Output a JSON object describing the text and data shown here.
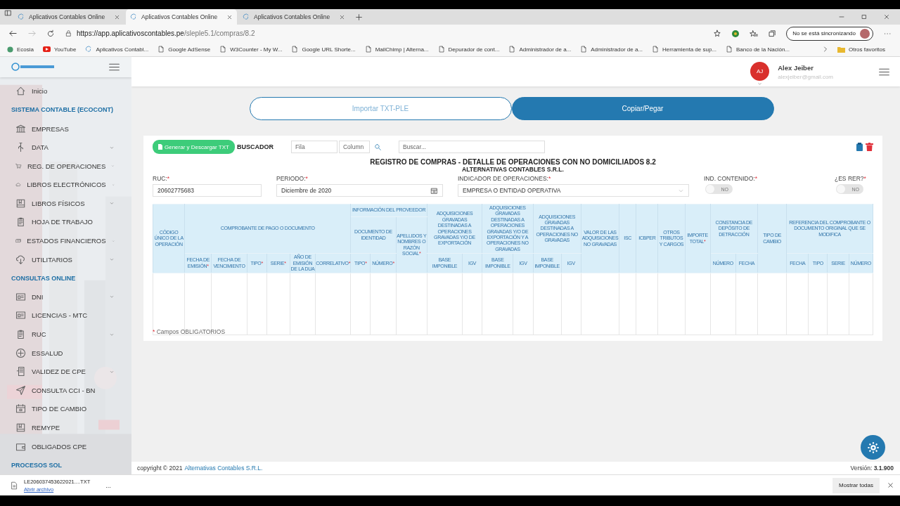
{
  "browser": {
    "tabs": [
      {
        "title": "Aplicativos Contables Online",
        "selected": false
      },
      {
        "title": "Aplicativos Contables Online",
        "selected": true
      },
      {
        "title": "Aplicativos Contables Online",
        "selected": false
      }
    ],
    "url_host": "https://app.aplicativoscontables.pe",
    "url_path": "/sleple5.1/compras/8.2",
    "sync_status": "No se está sincronizando",
    "bookmarks": [
      {
        "label": "Ecosia",
        "kind": "leaf"
      },
      {
        "label": "YouTube",
        "kind": "video"
      },
      {
        "label": "Aplicativos Contabl...",
        "kind": "site"
      },
      {
        "label": "Google AdSense",
        "kind": "page"
      },
      {
        "label": "W3Counter - My W...",
        "kind": "page"
      },
      {
        "label": "Google URL Shorte...",
        "kind": "page"
      },
      {
        "label": "MailChimp | Alterna...",
        "kind": "page"
      },
      {
        "label": "Depurador de cont...",
        "kind": "page"
      },
      {
        "label": "Administrador de a...",
        "kind": "page"
      },
      {
        "label": "Administrador de a...",
        "kind": "page"
      },
      {
        "label": "Herramienta de sup...",
        "kind": "page"
      },
      {
        "label": "Banco de la Nación...",
        "kind": "page"
      }
    ],
    "other_bookmarks": "Otros favoritos"
  },
  "sidebar": {
    "items": [
      {
        "kind": "link",
        "label": "Inicio",
        "expandable": false
      },
      {
        "kind": "heading",
        "label": "SISTEMA CONTABLE (ECOCONT)"
      },
      {
        "kind": "link",
        "label": "EMPRESAS",
        "expandable": false
      },
      {
        "kind": "link",
        "label": "DATA",
        "expandable": true
      },
      {
        "kind": "link",
        "label": "REG. DE OPERACIONES",
        "expandable": true
      },
      {
        "kind": "link",
        "label": "LIBROS ELECTRÓNICOS",
        "expandable": true
      },
      {
        "kind": "link",
        "label": "LIBROS FÍSICOS",
        "expandable": true
      },
      {
        "kind": "link",
        "label": "HOJA DE TRABAJO",
        "expandable": false
      },
      {
        "kind": "link",
        "label": "ESTADOS FINANCIEROS",
        "expandable": true
      },
      {
        "kind": "link",
        "label": "UTILITARIOS",
        "expandable": true
      },
      {
        "kind": "heading",
        "label": "CONSULTAS ONLINE"
      },
      {
        "kind": "link",
        "label": "DNI",
        "expandable": true
      },
      {
        "kind": "link",
        "label": "LICENCIAS - MTC",
        "expandable": false
      },
      {
        "kind": "link",
        "label": "RUC",
        "expandable": true
      },
      {
        "kind": "link",
        "label": "ESSALUD",
        "expandable": false
      },
      {
        "kind": "link",
        "label": "VALIDEZ DE CPE",
        "expandable": true
      },
      {
        "kind": "link",
        "label": "CONSULTA CCI - BN",
        "expandable": false
      },
      {
        "kind": "link",
        "label": "TIPO DE CAMBIO",
        "expandable": false
      },
      {
        "kind": "link",
        "label": "REMYPE",
        "expandable": false
      },
      {
        "kind": "link",
        "label": "OBLIGADOS CPE",
        "expandable": false
      },
      {
        "kind": "heading",
        "label": "PROCESOS SOL"
      }
    ]
  },
  "user": {
    "initials": "AJ",
    "name": "Alex Jeiber",
    "email": "alexjeiber@gmail.com"
  },
  "mode_tabs": [
    {
      "label": "Importar TXT-PLE",
      "selected": false
    },
    {
      "label": "Copiar/Pegar",
      "selected": true
    }
  ],
  "toolbar": {
    "generate_button": "Generar y Descargar TXT",
    "search_label": "BUSCADOR",
    "row_placeholder": "Fila",
    "column_placeholder": "Column",
    "search_placeholder": "Buscar..."
  },
  "title": "REGISTRO DE COMPRAS - DETALLE DE OPERACIONES CON NO DOMICILIADOS 8.2",
  "company": "ALTERNATIVAS CONTABLES S.R.L.",
  "form": {
    "ruc": {
      "label": "RUC:",
      "req": "*",
      "value": "20602775683"
    },
    "period": {
      "label": "PERIODO:",
      "req": "*",
      "value": "Diciembre de 2020"
    },
    "indicator": {
      "label": "INDICADOR DE OPERACIONES:",
      "req": "*",
      "value": "EMPRESA O ENTIDAD OPERATIVA"
    },
    "toggles": [
      {
        "label": "IND. CONTENIDO:",
        "req": "*",
        "text": "NO",
        "on": false
      },
      {
        "label": "¿ES RER?",
        "req": "*",
        "text": "NO",
        "on": false
      }
    ]
  },
  "table": {
    "columns": [
      {
        "label": "CÓDIGO ÚNICO DE LA OPERACIÓN"
      },
      {
        "label": "COMPROBANTE DE PAGO O DOCUMENTO",
        "children": [
          {
            "label": "FECHA DE EMISIÓN",
            "req": "*"
          },
          {
            "label": "FECHA DE VENCIMIENTO"
          },
          {
            "label": "TIPO",
            "req": "*"
          },
          {
            "label": "SERIE",
            "req": "*"
          },
          {
            "label": "AÑO DE EMISIÓN DE LA DUA"
          },
          {
            "label": "CORRELATIVO",
            "req": "*"
          }
        ]
      },
      {
        "label": "INFORMACIÓN DEL PROVEEDOR",
        "children": [
          {
            "label": "DOCUMENTO DE IDENTIDAD",
            "children": [
              {
                "label": "TIPO",
                "req": "*"
              },
              {
                "label": "NÚMERO",
                "req": "*"
              }
            ]
          },
          {
            "label": "APELLIDOS Y NOMBRES O RAZÓN SOCIAL",
            "req": "*"
          }
        ]
      },
      {
        "label": "ADQUISICIONES GRAVADAS DESTINADAS A OPERACIONES GRAVADAS Y/O DE EXPORTACIÓN",
        "children": [
          {
            "label": "BASE IMPONIBLE"
          },
          {
            "label": "IGV"
          }
        ]
      },
      {
        "label": "ADQUISICIONES GRAVADAS DESTINADAS A OPERACIONES GRAVADAS Y/O DE EXPORTACIÓN Y A OPERACIONES NO GRAVADAS",
        "children": [
          {
            "label": "BASE IMPONIBLE"
          },
          {
            "label": "IGV"
          }
        ]
      },
      {
        "label": "ADQUISICIONES GRAVADAS DESTINADAS A OPERACIONES NO GRAVADAS",
        "children": [
          {
            "label": "BASE IMPONIBLE"
          },
          {
            "label": "IGV"
          }
        ]
      },
      {
        "label": "VALOR DE LAS ADQUISICIONES NO GRAVADAS"
      },
      {
        "label": "ISC"
      },
      {
        "label": "ICBPER"
      },
      {
        "label": "OTROS TRIBUTOS Y CARGOS"
      },
      {
        "label": "IMPORTE TOTAL",
        "req": "*"
      },
      {
        "label": "CONSTANCIA DE DEPÓSITO DE DETRACCIÓN",
        "children": [
          {
            "label": "NÚMERO"
          },
          {
            "label": "FECHA"
          }
        ]
      },
      {
        "label": "TIPO DE CAMBIO"
      },
      {
        "label": "REFERENCIA DEL COMPROBANTE O DOCUMENTO ORIGINAL QUE SE MODIFICA",
        "children": [
          {
            "label": "FECHA"
          },
          {
            "label": "TIPO"
          },
          {
            "label": "SERIE"
          },
          {
            "label": "NÚMERO"
          }
        ]
      }
    ]
  },
  "required_note": {
    "req": "*",
    "text": "Campos OBLIGATORIOS"
  },
  "footer": {
    "copyright": "copyright © 2021",
    "company_link": "Alternativas Contables S.R.L.",
    "version": "Versión: **3.1.900**"
  },
  "download": {
    "file": "LE206037453622021....TXT",
    "open_link": "Abrir archivo",
    "more": "...",
    "show_all": "Mostrar todas"
  }
}
